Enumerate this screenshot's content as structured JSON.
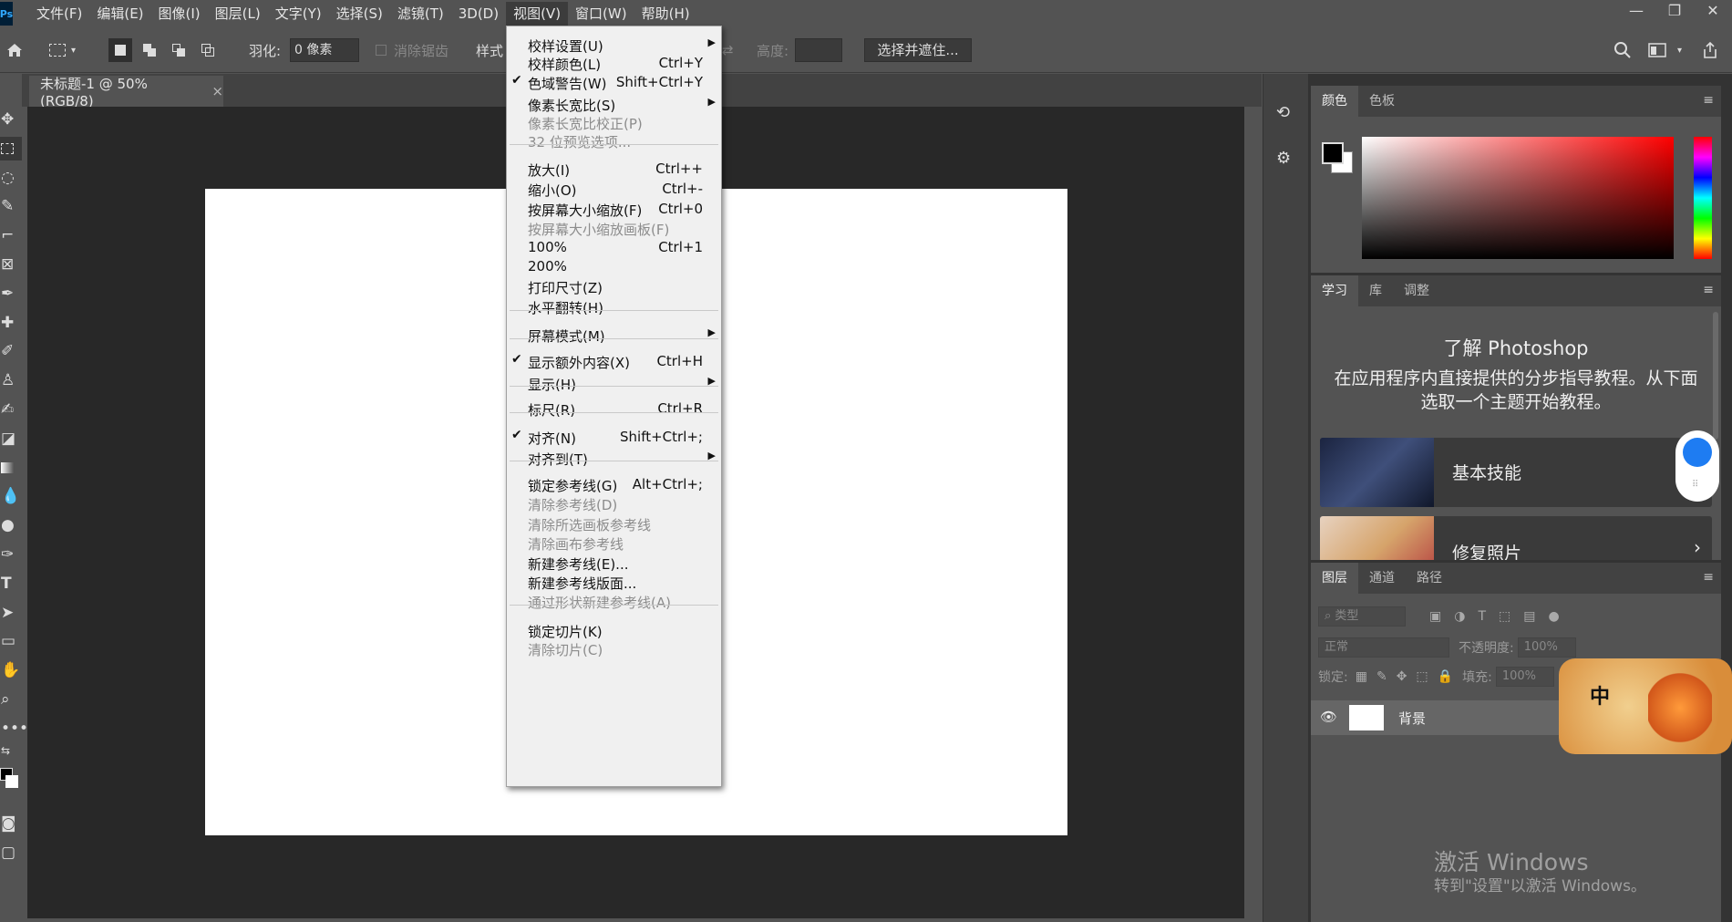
{
  "app": {
    "logo": "Ps"
  },
  "menubar": [
    "文件(F)",
    "编辑(E)",
    "图像(I)",
    "图层(L)",
    "文字(Y)",
    "选择(S)",
    "滤镜(T)",
    "3D(D)",
    "视图(V)",
    "窗口(W)",
    "帮助(H)"
  ],
  "window_controls": {
    "minimize": "—",
    "restore": "❐",
    "close": "✕"
  },
  "options": {
    "feather_label": "羽化:",
    "feather_value": "0 像素",
    "antialias_label": "消除锯齿",
    "style_label": "样式",
    "height_label": "高度:",
    "select_mask_button": "选择并遮住..."
  },
  "document": {
    "tab_title": "未标题-1 @ 50%(RGB/8)",
    "close": "×"
  },
  "panels": {
    "color": {
      "tabs": [
        "颜色",
        "色板"
      ]
    },
    "learn": {
      "tabs": [
        "学习",
        "库",
        "调整"
      ],
      "title": "了解 Photoshop",
      "description": "在应用程序内直接提供的分步指导教程。从下面选取一个主题开始教程。",
      "cards": [
        "基本技能",
        "修复照片"
      ]
    },
    "layers": {
      "tabs": [
        "图层",
        "通道",
        "路径"
      ],
      "filter_placeholder": "类型",
      "blend_mode": "正常",
      "opacity_label": "不透明度:",
      "opacity_value": "100%",
      "lock_label": "锁定:",
      "fill_label": "填充:",
      "fill_value": "100%",
      "layer_name": "背景"
    }
  },
  "view_menu": {
    "items": [
      {
        "label": "校样设置(U)",
        "submenu": true
      },
      {
        "label": "校样颜色(L)",
        "shortcut": "Ctrl+Y"
      },
      {
        "label": "色域警告(W)",
        "shortcut": "Shift+Ctrl+Y",
        "checked": true
      },
      {
        "label": "像素长宽比(S)",
        "submenu": true
      },
      {
        "label": "像素长宽比校正(P)",
        "disabled": true
      },
      {
        "label": "32 位预览选项...",
        "disabled": true
      },
      {
        "label": "放大(I)",
        "shortcut": "Ctrl++"
      },
      {
        "label": "缩小(O)",
        "shortcut": "Ctrl+-"
      },
      {
        "label": "按屏幕大小缩放(F)",
        "shortcut": "Ctrl+0"
      },
      {
        "label": "按屏幕大小缩放画板(F)",
        "disabled": true
      },
      {
        "label": "100%",
        "shortcut": "Ctrl+1"
      },
      {
        "label": "200%"
      },
      {
        "label": "打印尺寸(Z)"
      },
      {
        "label": "水平翻转(H)"
      },
      {
        "label": "屏幕模式(M)",
        "submenu": true
      },
      {
        "label": "显示额外内容(X)",
        "shortcut": "Ctrl+H",
        "checked": true
      },
      {
        "label": "显示(H)",
        "submenu": true
      },
      {
        "label": "标尺(R)",
        "shortcut": "Ctrl+R"
      },
      {
        "label": "对齐(N)",
        "shortcut": "Shift+Ctrl+;",
        "checked": true
      },
      {
        "label": "对齐到(T)",
        "submenu": true
      },
      {
        "label": "锁定参考线(G)",
        "shortcut": "Alt+Ctrl+;"
      },
      {
        "label": "清除参考线(D)",
        "disabled": true
      },
      {
        "label": "清除所选画板参考线",
        "disabled": true
      },
      {
        "label": "清除画布参考线",
        "disabled": true
      },
      {
        "label": "新建参考线(E)..."
      },
      {
        "label": "新建参考线版面..."
      },
      {
        "label": "通过形状新建参考线(A)",
        "disabled": true
      },
      {
        "label": "锁定切片(K)"
      },
      {
        "label": "清除切片(C)",
        "disabled": true
      }
    ]
  },
  "sticker": {
    "char": "中"
  },
  "watermark": {
    "line1": "激活 Windows",
    "line2": "转到\"设置\"以激活 Windows。"
  }
}
